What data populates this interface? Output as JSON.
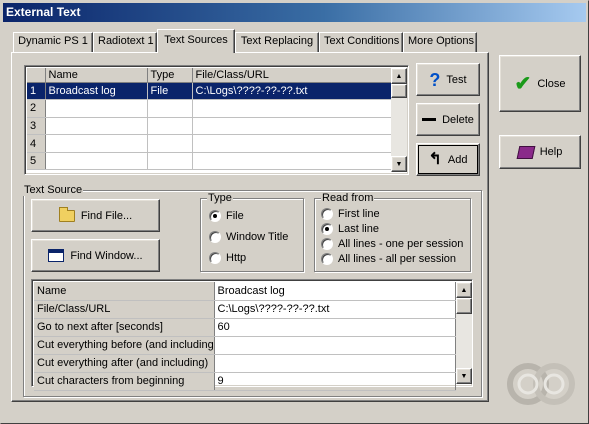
{
  "window": {
    "title": "External Text"
  },
  "tabs": [
    {
      "label": "Dynamic PS 1"
    },
    {
      "label": "Radiotext 1"
    },
    {
      "label": "Text Sources"
    },
    {
      "label": "Text Replacing"
    },
    {
      "label": "Text Conditions"
    },
    {
      "label": "More Options"
    }
  ],
  "sources_grid": {
    "columns": [
      "Name",
      "Type",
      "File/Class/URL"
    ],
    "rows": [
      {
        "num": "1",
        "name": "Broadcast log",
        "type": "File",
        "url": "C:\\Logs\\????-??-??.txt"
      },
      {
        "num": "2",
        "name": "",
        "type": "",
        "url": ""
      },
      {
        "num": "3",
        "name": "",
        "type": "",
        "url": ""
      },
      {
        "num": "4",
        "name": "",
        "type": "",
        "url": ""
      },
      {
        "num": "5",
        "name": "",
        "type": "",
        "url": ""
      }
    ]
  },
  "grid_buttons": {
    "test": "Test",
    "delete": "Delete",
    "add": "Add"
  },
  "side_buttons": {
    "close": "Close",
    "help": "Help"
  },
  "text_source": {
    "label": "Text Source",
    "find_file": "Find File...",
    "find_window": "Find Window..."
  },
  "type_group": {
    "label": "Type",
    "options": [
      "File",
      "Window Title",
      "Http"
    ],
    "selected": "File"
  },
  "read_from": {
    "label": "Read from",
    "options": [
      "First line",
      "Last line",
      "All lines - one per session",
      "All lines - all per session"
    ],
    "selected": "Last line"
  },
  "properties": [
    {
      "key": "Name",
      "value": "Broadcast log"
    },
    {
      "key": "File/Class/URL",
      "value": "C:\\Logs\\????-??-??.txt"
    },
    {
      "key": "Go to next after [seconds]",
      "value": "60"
    },
    {
      "key": "Cut everything before (and including)",
      "value": ""
    },
    {
      "key": "Cut everything after (and including)",
      "value": ""
    },
    {
      "key": "Cut characters from beginning",
      "value": "9"
    }
  ],
  "colors": {
    "selection": "#0a246a",
    "face": "#d4d0c8",
    "check": "#1a9a1a"
  }
}
